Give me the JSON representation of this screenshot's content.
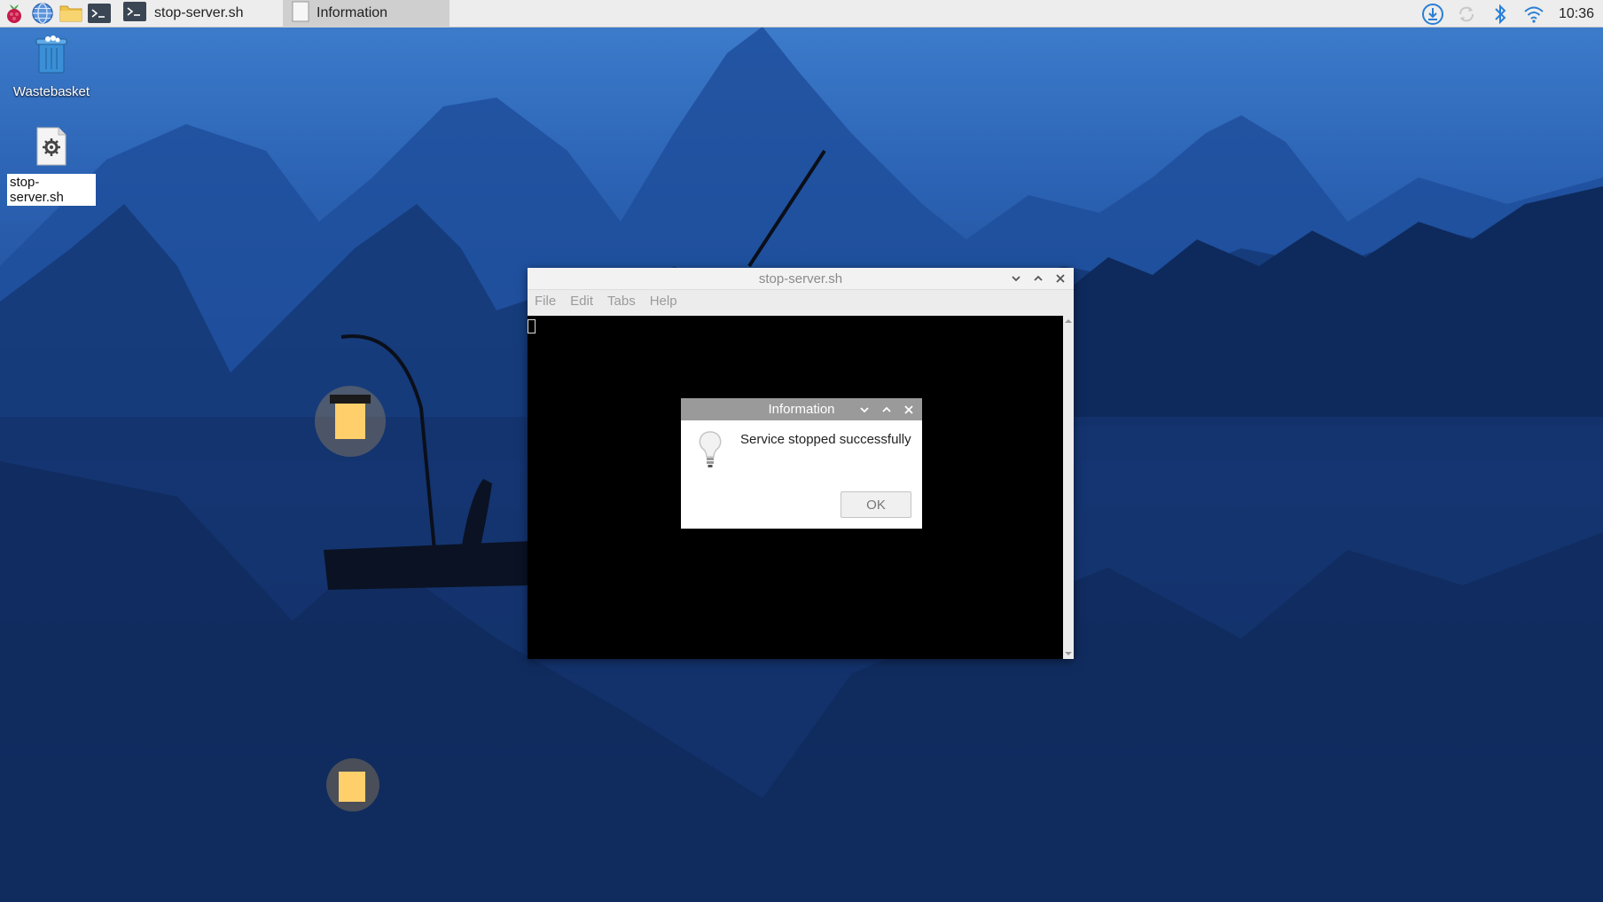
{
  "taskbar": {
    "launchers": [
      {
        "name": "raspberry-menu-icon"
      },
      {
        "name": "web-browser-icon"
      },
      {
        "name": "file-manager-icon"
      },
      {
        "name": "terminal-icon"
      }
    ],
    "tasks": [
      {
        "label": "stop-server.sh",
        "active": false
      },
      {
        "label": "Information",
        "active": true
      }
    ],
    "tray": {
      "icons": [
        "update-download-icon",
        "network-sync-icon",
        "bluetooth-icon",
        "wifi-icon"
      ],
      "clock": "10:36"
    }
  },
  "desktop": {
    "icons": [
      {
        "label": "Wastebasket",
        "icon": "trash-icon",
        "selected": false
      },
      {
        "label": "stop-server.sh",
        "icon": "script-file-icon",
        "selected": true
      }
    ]
  },
  "terminal_window": {
    "title": "stop-server.sh",
    "menu": [
      "File",
      "Edit",
      "Tabs",
      "Help"
    ]
  },
  "dialog": {
    "title": "Information",
    "message": "Service stopped successfully",
    "icon": "lightbulb-icon",
    "ok_label": "OK"
  },
  "colors": {
    "panel_bg": "#ededed",
    "dialog_titlebar": "#9a9a9a",
    "terminal_bg": "#000000",
    "accent_blue": "#2a7fd4"
  }
}
